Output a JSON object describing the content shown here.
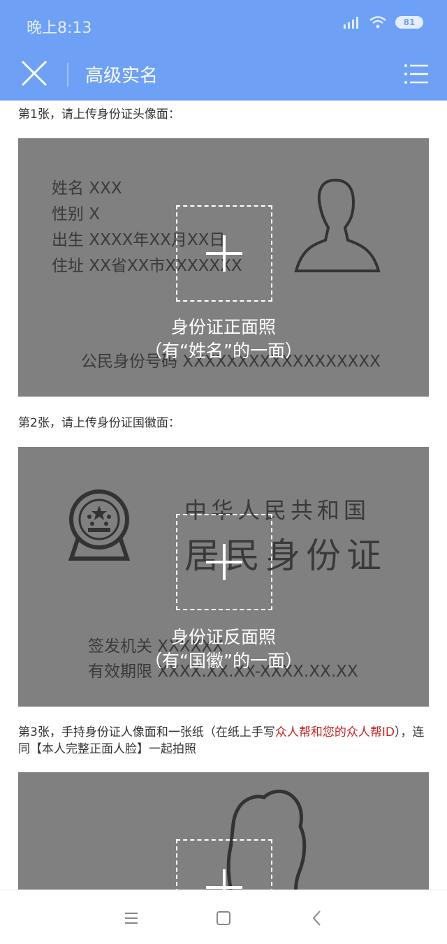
{
  "status": {
    "time": "晚上8:13",
    "battery": "81"
  },
  "header": {
    "title": "高级实名"
  },
  "steps": [
    {
      "label": "第1张，请上传身份证头像面：",
      "card": {
        "fields": [
          "姓名  XXX",
          "性别  X",
          "出生  XXXX年XX月XX日",
          "住址  XX省XX市XXXXXXX"
        ],
        "id_number": "公民身份号码  XXXXXXXXXXXXXXXXXX",
        "caption_line1": "身份证正面照",
        "caption_line2": "（有“姓名”的一面）"
      }
    },
    {
      "label": "第2张，请上传身份证国徽面：",
      "card": {
        "country": "中华人民共和国",
        "doc_title": "居民身份证",
        "issuer": "签发机关  XXXXXX",
        "validity": "有效期限  XXXX.XX.XX-XXXX.XX.XX",
        "caption_line1": "身份证反面照",
        "caption_line2": "（有“国徽”的一面）"
      }
    },
    {
      "label_pre": "第3张，手持身份证人像面和一张纸（在纸上手写",
      "label_red": "众人帮和您的众人帮ID",
      "label_post": "），连同【本人完整正面人脸】一起拍照"
    }
  ]
}
